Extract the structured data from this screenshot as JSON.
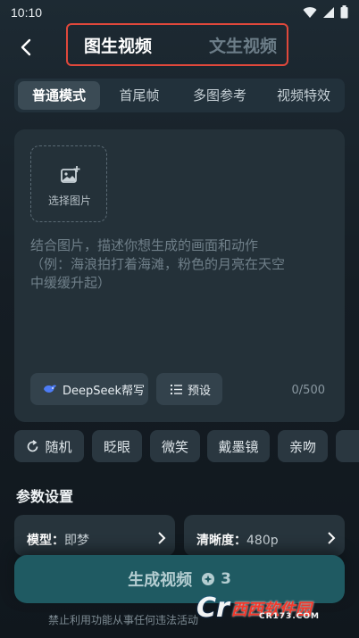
{
  "status_bar": {
    "time": "10:10",
    "icons": [
      "signal-icon",
      "wifi-icon",
      "battery-icon"
    ]
  },
  "header": {
    "back_icon": "back-arrow-icon",
    "tabs": [
      {
        "label": "图生视频",
        "active": true
      },
      {
        "label": "文生视频",
        "active": false
      }
    ],
    "highlight_color": "#e0483b"
  },
  "sub_tabs": [
    {
      "label": "普通模式",
      "active": true
    },
    {
      "label": "首尾帧",
      "active": false
    },
    {
      "label": "多图参考",
      "active": false
    },
    {
      "label": "视频特效",
      "active": false
    }
  ],
  "editor": {
    "upload_label": "选择图片",
    "upload_icon": "add-image-icon",
    "placeholder_lines": [
      "结合图片，描述你想生成的画面和动作",
      "（例：海浪拍打着海滩，粉色的月亮在天空",
      "中缓缓升起）"
    ],
    "deepseek_button": "DeepSeek帮写",
    "preset_button": "预设",
    "char_count": "0/500"
  },
  "chips": [
    {
      "label": "随机",
      "icon": "refresh-icon"
    },
    {
      "label": "眨眼"
    },
    {
      "label": "微笑"
    },
    {
      "label": "戴墨镜"
    },
    {
      "label": "亲吻"
    }
  ],
  "params": {
    "title": "参数设置",
    "model_label": "模型：",
    "model_value": "即梦",
    "resolution_label": "清晰度：",
    "resolution_value": "480p"
  },
  "generate": {
    "label": "生成视频",
    "credits": "3",
    "accent": "#1f5a62"
  },
  "disclaimer": "禁止利用功能从事任何违法活动",
  "watermark": {
    "mark": "Cr",
    "title": "西西软件园",
    "sub": "CR173.COM"
  }
}
